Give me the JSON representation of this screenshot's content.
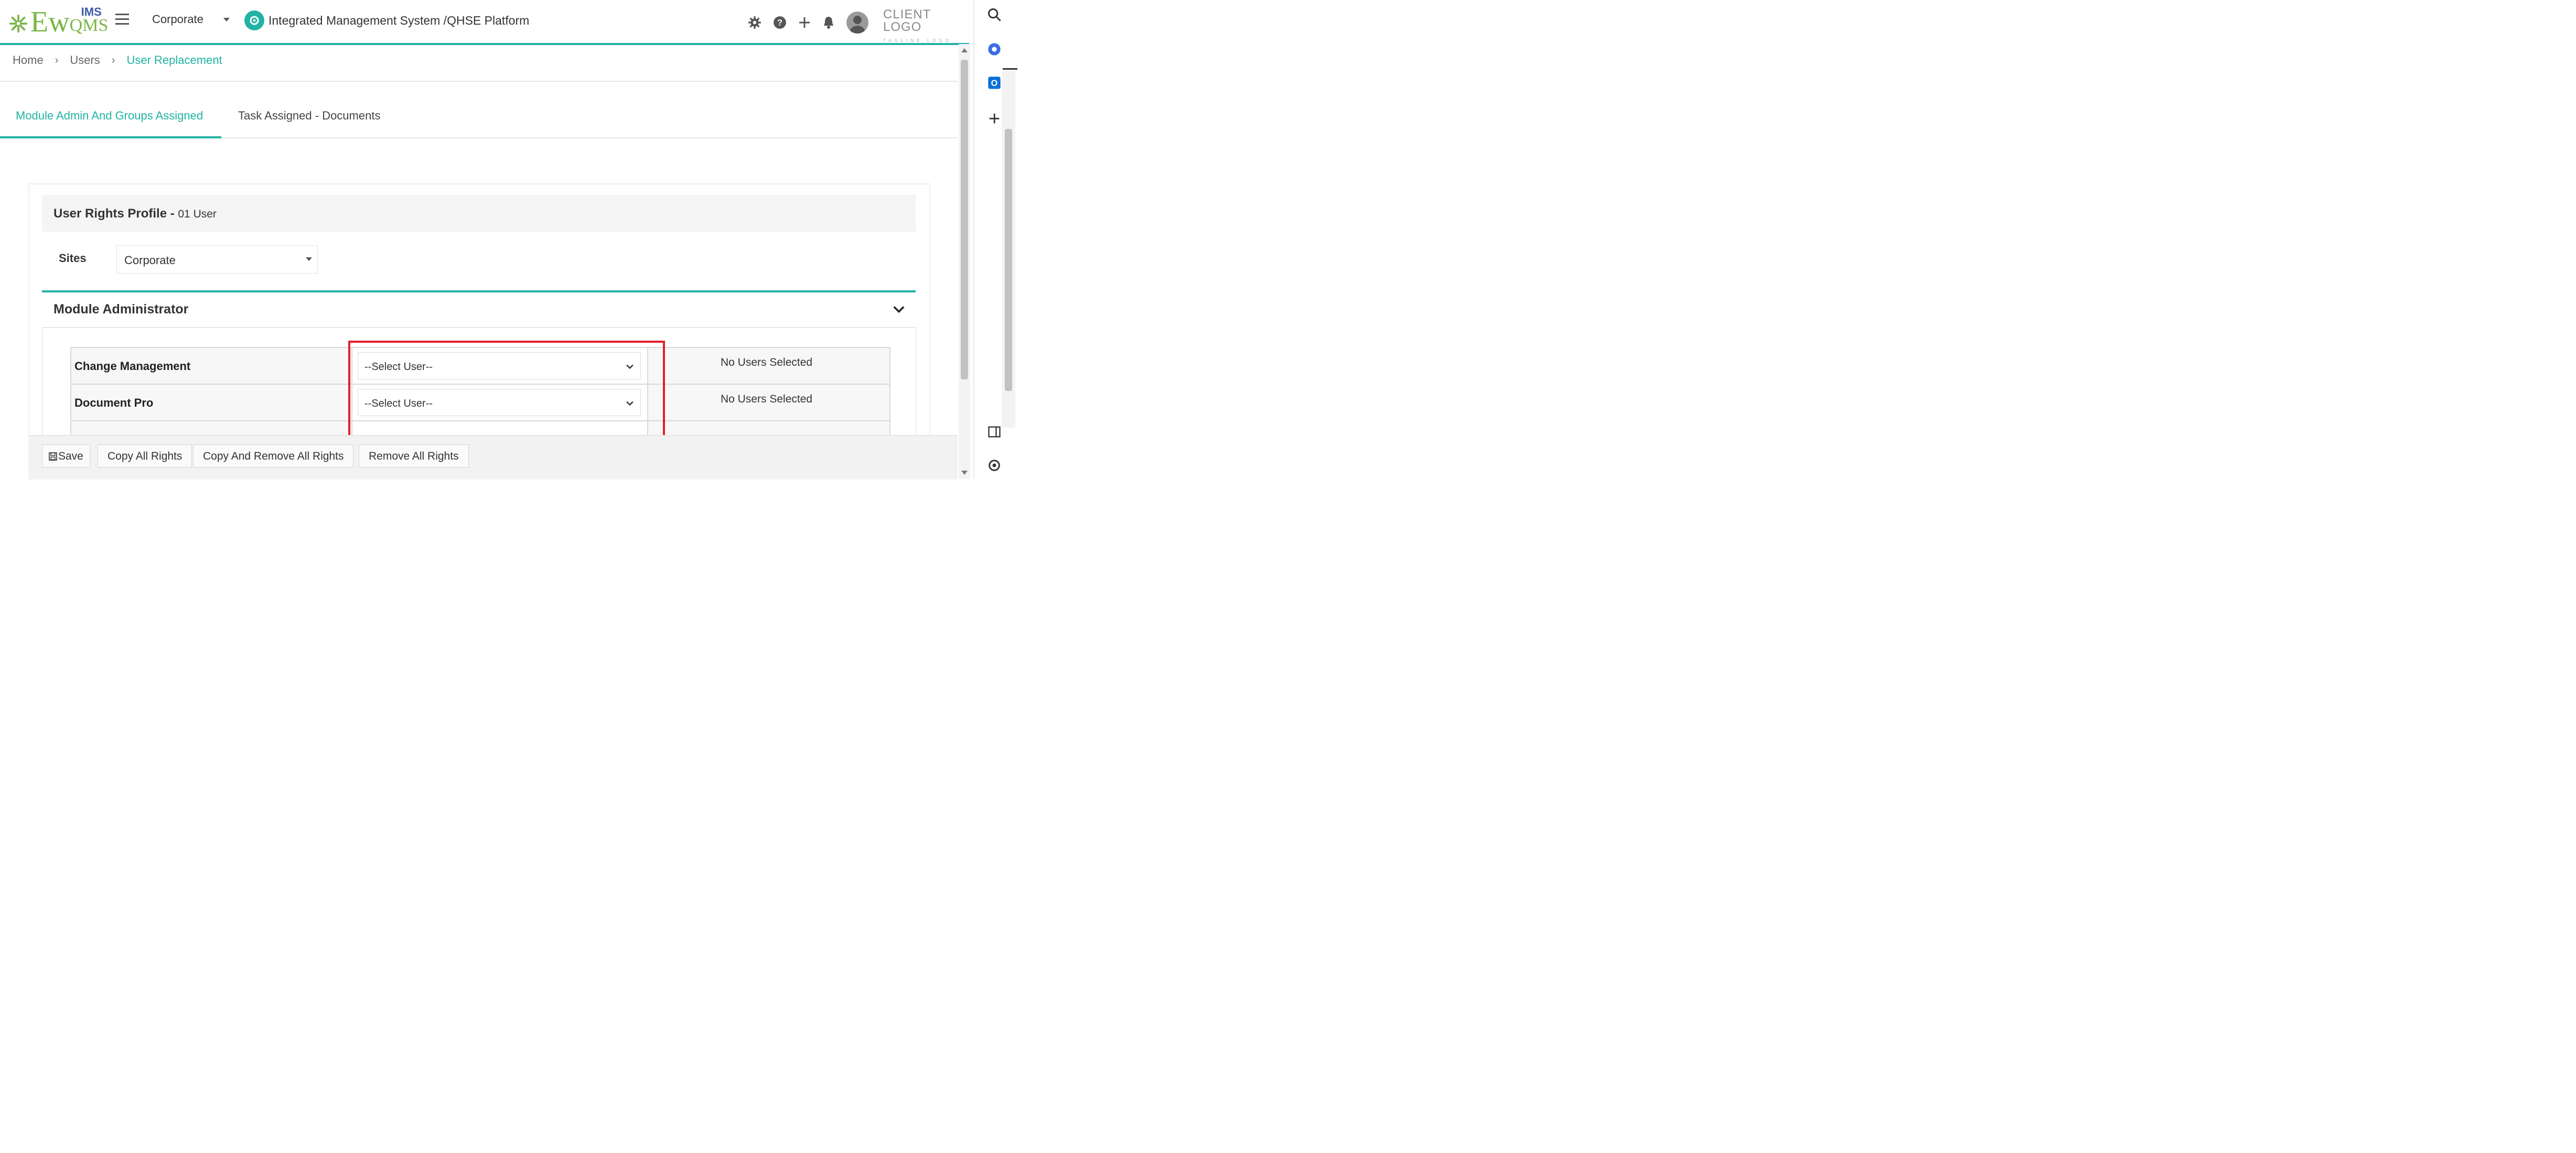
{
  "header": {
    "logo": {
      "ew": "Ew",
      "qms": "QMS",
      "ims": "IMS"
    },
    "site_selector": "Corporate",
    "platform_title": "Integrated Management System /QHSE Platform",
    "client_logo": "CLIENT LOGO",
    "client_logo_sub": "TAGLINE LOGO",
    "icons": [
      "gear-icon",
      "help-icon",
      "plus-icon",
      "bell-icon",
      "avatar"
    ]
  },
  "breadcrumb": {
    "home": "Home",
    "users": "Users",
    "current": "User Replacement"
  },
  "tabs": [
    {
      "label": "Module Admin And Groups Assigned",
      "active": true
    },
    {
      "label": "Task Assigned - Documents",
      "active": false
    }
  ],
  "profile": {
    "title": "User Rights Profile - ",
    "user": "01 User"
  },
  "sites": {
    "label": "Sites",
    "value": "Corporate"
  },
  "module_admin": {
    "title": "Module Administrator",
    "rows": [
      {
        "name": "Change Management",
        "select": "--Select User--",
        "status": "No Users Selected"
      },
      {
        "name": "Document Pro",
        "select": "--Select User--",
        "status": "No Users Selected"
      }
    ]
  },
  "toolbar": {
    "save": "Save",
    "copy_all": "Copy All Rights",
    "copy_remove": "Copy And Remove All Rights",
    "remove_all": "Remove All Rights"
  },
  "colors": {
    "accent": "#21b3a4",
    "logo_green": "#7ab648",
    "highlight": "#e0212b"
  }
}
